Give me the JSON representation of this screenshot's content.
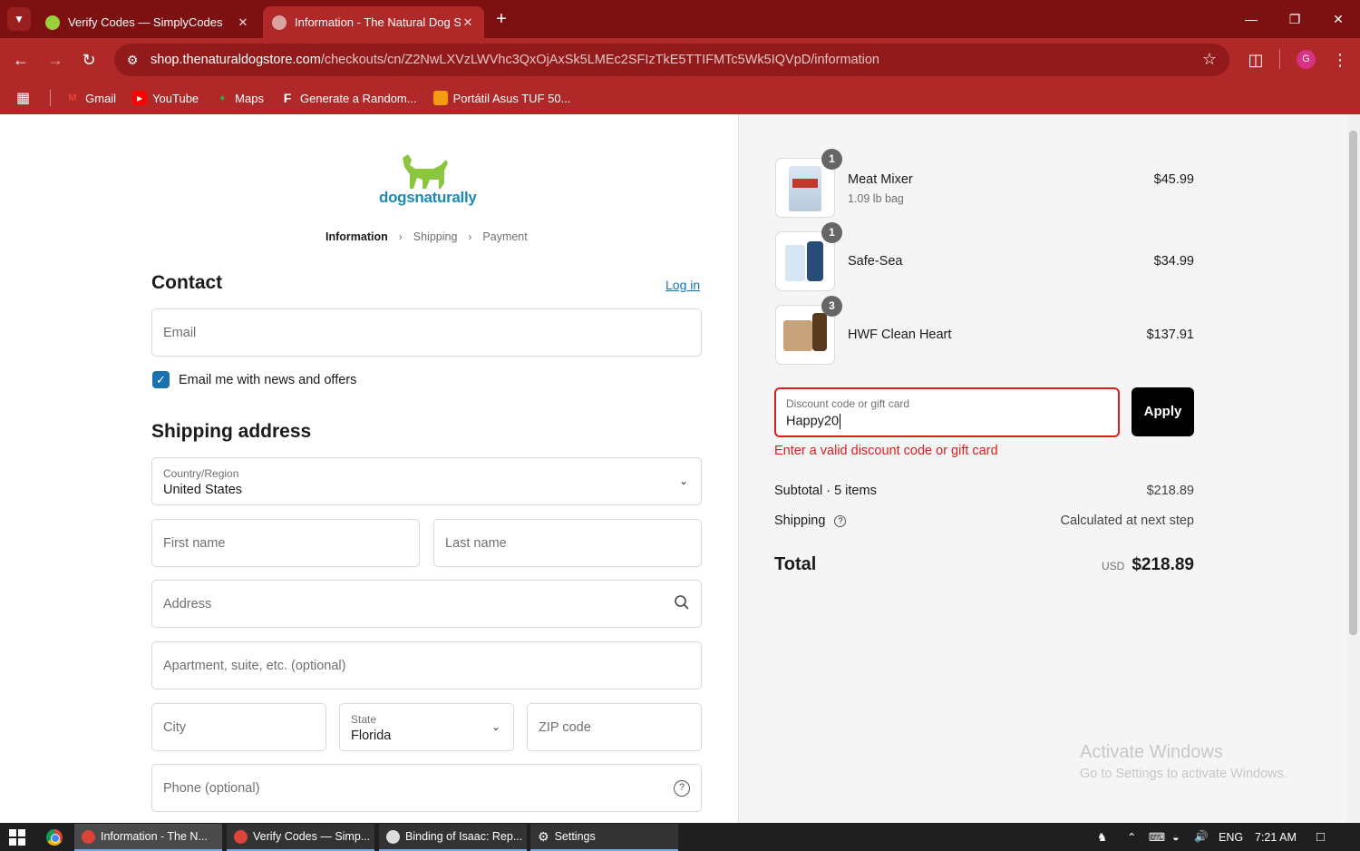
{
  "browser": {
    "tabs": [
      {
        "title": "Verify Codes — SimplyCodes",
        "favicon": "simplycodes-icon",
        "active": false
      },
      {
        "title": "Information - The Natural Dog S",
        "favicon": "globe-icon",
        "active": true
      }
    ],
    "url_host": "shop.thenaturaldogstore.com",
    "url_path": "/checkouts/cn/Z2NwLXVzLWVhc3QxOjAxSk5LMEc2SFIzTkE5TTIFMTc5Wk5IQVpD/information",
    "bookmarks": [
      {
        "label": "Gmail",
        "icon": "gmail-icon"
      },
      {
        "label": "YouTube",
        "icon": "youtube-icon"
      },
      {
        "label": "Maps",
        "icon": "maps-icon"
      },
      {
        "label": "Generate a Random...",
        "icon": "f-icon"
      },
      {
        "label": "Portátil Asus TUF 50...",
        "icon": "shop-icon"
      }
    ],
    "profile_initial": "G",
    "theme_color": "#b12828"
  },
  "checkout": {
    "logo_text": "dogsnaturally",
    "breadcrumbs": [
      "Information",
      "Shipping",
      "Payment"
    ],
    "contact_title": "Contact",
    "login_label": "Log in",
    "email_placeholder": "Email",
    "email_opt_in_label": "Email me with news and offers",
    "email_opt_in_checked": true,
    "shipping_title": "Shipping address",
    "country_label": "Country/Region",
    "country_value": "United States",
    "first_name_placeholder": "First name",
    "last_name_placeholder": "Last name",
    "address_placeholder": "Address",
    "apartment_placeholder": "Apartment, suite, etc. (optional)",
    "city_placeholder": "City",
    "state_label": "State",
    "state_value": "Florida",
    "zip_placeholder": "ZIP code",
    "phone_placeholder": "Phone (optional)"
  },
  "summary": {
    "items": [
      {
        "name": "Meat Mixer",
        "variant": "1.09 lb bag",
        "qty": "1",
        "price": "$45.99"
      },
      {
        "name": "Safe-Sea",
        "variant": "",
        "qty": "1",
        "price": "$34.99"
      },
      {
        "name": "HWF Clean Heart",
        "variant": "",
        "qty": "3",
        "price": "$137.91"
      }
    ],
    "discount_label": "Discount code or gift card",
    "discount_value": "Happy20",
    "apply_label": "Apply",
    "error_text": "Enter a valid discount code or gift card",
    "subtotal_label": "Subtotal · 5 items",
    "subtotal_value": "$218.89",
    "shipping_label": "Shipping",
    "shipping_value": "Calculated at next step",
    "total_label": "Total",
    "total_currency": "USD",
    "total_value": "$218.89",
    "error_color": "#dd1d1d",
    "link_color": "#1773b0"
  },
  "watermark": {
    "title": "Activate Windows",
    "subtitle": "Go to Settings to activate Windows."
  },
  "taskbar": {
    "apps": [
      {
        "label": "Information - The N...",
        "active": true
      },
      {
        "label": "Verify Codes — Simp...",
        "active": false
      },
      {
        "label": "Binding of Isaac: Rep...",
        "active": false
      },
      {
        "label": "Settings",
        "active": false
      }
    ],
    "language": "ENG",
    "time": "7:21 AM"
  }
}
